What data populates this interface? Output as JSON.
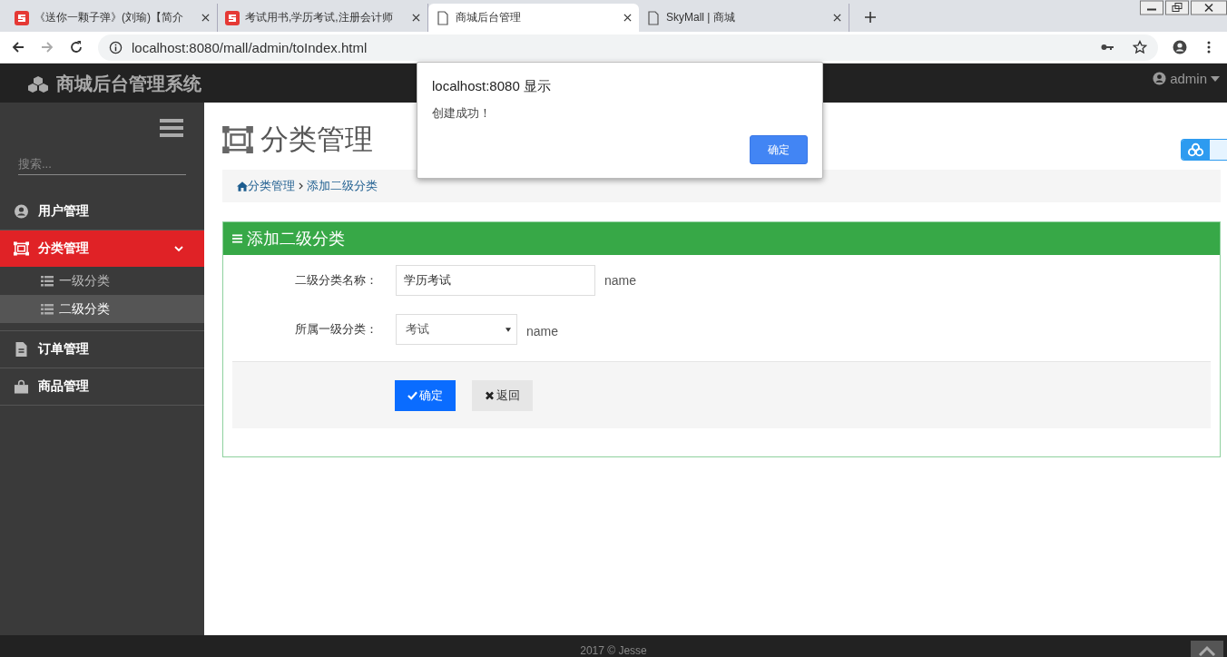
{
  "browser": {
    "tabs": [
      {
        "title": "《送你一颗子弹》(刘瑜)【简介",
        "kind": "site",
        "selected": false
      },
      {
        "title": "考试用书,学历考试,注册会计师",
        "kind": "site",
        "selected": false
      },
      {
        "title": "商城后台管理",
        "kind": "page",
        "selected": true
      },
      {
        "title": "SkyMall | 商城",
        "kind": "page",
        "selected": false
      }
    ],
    "address": "localhost:8080/mall/admin/toIndex.html"
  },
  "navbar": {
    "brand": "商城后台管理系统",
    "user": "admin"
  },
  "sidebar": {
    "search_placeholder": "搜索...",
    "items": [
      {
        "label": "用户管理",
        "kind": "user",
        "selected": false
      },
      {
        "label": "分类管理",
        "kind": "category",
        "selected": true,
        "expanded": true,
        "children": [
          {
            "label": "一级分类",
            "selected": false
          },
          {
            "label": "二级分类",
            "selected": true
          }
        ]
      },
      {
        "label": "订单管理",
        "kind": "file",
        "selected": false
      },
      {
        "label": "商品管理",
        "kind": "bag",
        "selected": false
      }
    ]
  },
  "page": {
    "title": "分类管理",
    "breadcrumb": [
      "分类管理",
      "添加二级分类"
    ],
    "panel": {
      "title": "添加二级分类",
      "fields": [
        {
          "kind": "text",
          "label": "二级分类名称：",
          "value": "学历考试",
          "hint": "name"
        },
        {
          "kind": "select",
          "label": "所属一级分类：",
          "value": "考试",
          "hint": "name"
        }
      ],
      "buttons": [
        {
          "kind": "primary",
          "label": "确定"
        },
        {
          "kind": "default",
          "label": "返回"
        }
      ]
    }
  },
  "dialog": {
    "title": "localhost:8080 显示",
    "message": "创建成功！",
    "button": "确定"
  },
  "footer": "2017 © Jesse"
}
